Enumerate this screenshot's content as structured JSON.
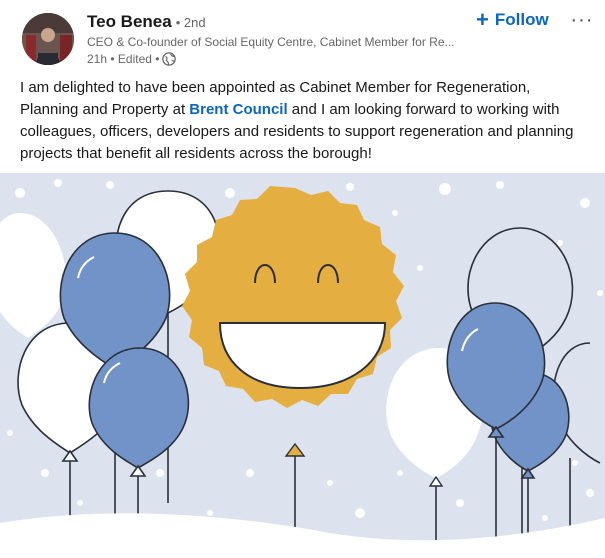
{
  "post": {
    "author": {
      "name": "Teo Benea",
      "degree": "• 2nd",
      "headline": "CEO & Co-founder of Social Equity Centre, Cabinet Member for Re...",
      "timestamp": "21h • Edited •",
      "visibility_icon": "globe-icon"
    },
    "follow_label": "Follow",
    "follow_icon": "plus-icon",
    "more_label": "···",
    "text": {
      "before_mention": "I am delighted to have been appointed as Cabinet Member for Regeneration, Planning and Property at ",
      "mention": "Brent Council",
      "after_mention": " and I am looking forward to working with colleagues, officers, developers and residents to support regeneration and planning projects that benefit all residents across the borough!"
    },
    "image": {
      "description_icon": "celebration-balloons-smiley",
      "colors": {
        "background": "#dde3ee",
        "blue_balloon": "#7193c8",
        "white_balloon": "#ffffff",
        "smiley": "#e5ae40",
        "outline": "#2a2f3a"
      }
    }
  },
  "theme": {
    "link_color": "#0a66c2",
    "muted_text": "#666666"
  }
}
